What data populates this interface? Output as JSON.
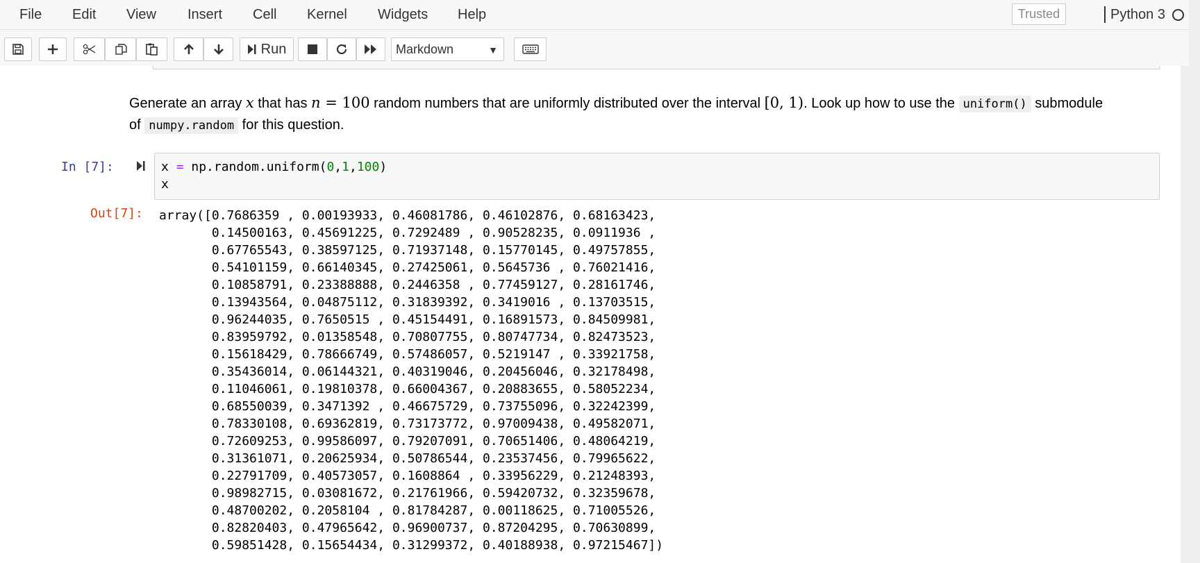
{
  "menubar": {
    "items": [
      "File",
      "Edit",
      "View",
      "Insert",
      "Cell",
      "Kernel",
      "Widgets",
      "Help"
    ],
    "trusted_label": "Trusted",
    "kernel_name": "Python 3"
  },
  "toolbar": {
    "run_label": "Run",
    "cell_type": "Markdown",
    "icons": [
      "save-icon",
      "plus-icon",
      "scissors-icon",
      "copy-icon",
      "paste-icon",
      "arrow-up-icon",
      "arrow-down-icon",
      "run-icon",
      "stop-icon",
      "restart-icon",
      "fast-forward-icon",
      "keyboard-icon"
    ]
  },
  "markdown_cell": {
    "t1": "Generate an array ",
    "var_x": "x",
    "t2": " that has ",
    "var_n": "n",
    "eq": " = 100",
    "t3": " random numbers that are uniformly distributed over the interval ",
    "interval": "[0, 1)",
    "t4": ". Look up how to use the ",
    "code1": "uniform()",
    "t5": " submodule",
    "t6": "of ",
    "code2": "numpy.random",
    "t7": " for this question."
  },
  "code_cell": {
    "prompt": "In [7]:",
    "line1": {
      "a": "x ",
      "op": "=",
      "b": " np.random.uniform(",
      "n1": "0",
      "c1": ",",
      "n2": "1",
      "c2": ",",
      "n3": "100",
      "close": ")"
    },
    "line2": "x",
    "out_prompt": "Out[7]:",
    "output_lines": [
      "array([0.7686359 , 0.00193933, 0.46081786, 0.46102876, 0.68163423,",
      "       0.14500163, 0.45691225, 0.7292489 , 0.90528235, 0.0911936 ,",
      "       0.67765543, 0.38597125, 0.71937148, 0.15770145, 0.49757855,",
      "       0.54101159, 0.66140345, 0.27425061, 0.5645736 , 0.76021416,",
      "       0.10858791, 0.23388888, 0.2446358 , 0.77459127, 0.28161746,",
      "       0.13943564, 0.04875112, 0.31839392, 0.3419016 , 0.13703515,",
      "       0.96244035, 0.7650515 , 0.45154491, 0.16891573, 0.84509981,",
      "       0.83959792, 0.01358548, 0.70807755, 0.80747734, 0.82473523,",
      "       0.15618429, 0.78666749, 0.57486057, 0.5219147 , 0.33921758,",
      "       0.35436014, 0.06144321, 0.40319046, 0.20456046, 0.32178498,",
      "       0.11046061, 0.19810378, 0.66004367, 0.20883655, 0.58052234,",
      "       0.68550039, 0.3471392 , 0.46675729, 0.73755096, 0.32242399,",
      "       0.78330108, 0.69362819, 0.73173772, 0.97009438, 0.49582071,",
      "       0.72609253, 0.99586097, 0.79207091, 0.70651406, 0.48064219,",
      "       0.31361071, 0.20625934, 0.50786544, 0.23537456, 0.79965622,",
      "       0.22791709, 0.40573057, 0.1608864 , 0.33956229, 0.21248393,",
      "       0.98982715, 0.03081672, 0.21761966, 0.59420732, 0.32359678,",
      "       0.48700202, 0.2058104 , 0.81784287, 0.00118625, 0.71005526,",
      "       0.82820403, 0.47965642, 0.96900737, 0.87204295, 0.70630899,",
      "       0.59851428, 0.15654434, 0.31299372, 0.40188938, 0.97215467])"
    ]
  },
  "colors": {
    "in_prompt": "#303f9f",
    "out_prompt": "#d84315",
    "operator": "#aa22ff",
    "number": "#008800"
  }
}
